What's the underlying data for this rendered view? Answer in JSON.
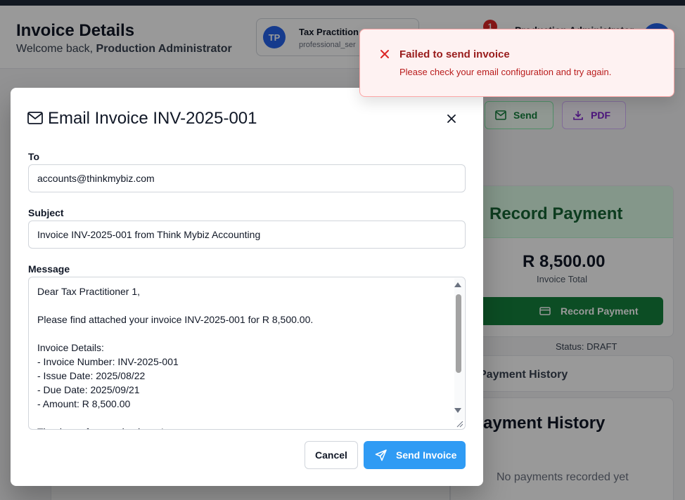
{
  "header": {
    "title": "Invoice Details",
    "welcome_prefix": "Welcome back,",
    "welcome_user": "Production Administrator",
    "user_chip": {
      "initials": "TP",
      "name": "Tax Practition",
      "role": "professional_ser"
    },
    "notification_count": "1",
    "admin_name": "Production Administrator"
  },
  "actions": {
    "send_label": "Send",
    "pdf_label": "PDF"
  },
  "payment": {
    "title": "Record Payment",
    "amount": "R 8,500.00",
    "amount_label": "Invoice Total",
    "button_label": "Record Payment",
    "status": "Status: DRAFT"
  },
  "history": {
    "tab_label": "Payment History",
    "title": "Payment History",
    "empty": "No payments recorded yet"
  },
  "modal": {
    "title": "Email Invoice INV-2025-001",
    "to_label": "To",
    "to_value": "accounts@thinkmybiz.com",
    "subject_label": "Subject",
    "subject_value": "Invoice INV-2025-001 from Think Mybiz Accounting",
    "message_label": "Message",
    "message_value": "Dear Tax Practitioner 1,\n\nPlease find attached your invoice INV-2025-001 for R 8,500.00.\n\nInvoice Details:\n- Invoice Number: INV-2025-001\n- Issue Date: 2025/08/22\n- Due Date: 2025/09/21\n- Amount: R 8,500.00\n\nThank you for your business!",
    "cancel_label": "Cancel",
    "send_label": "Send Invoice"
  },
  "toast": {
    "title": "Failed to send invoice",
    "description": "Please check your email configuration and try again."
  },
  "colors": {
    "primary": "#2f9bf4",
    "success": "#15803d",
    "error": "#dc2626",
    "toast_bg": "#fef2f2"
  }
}
